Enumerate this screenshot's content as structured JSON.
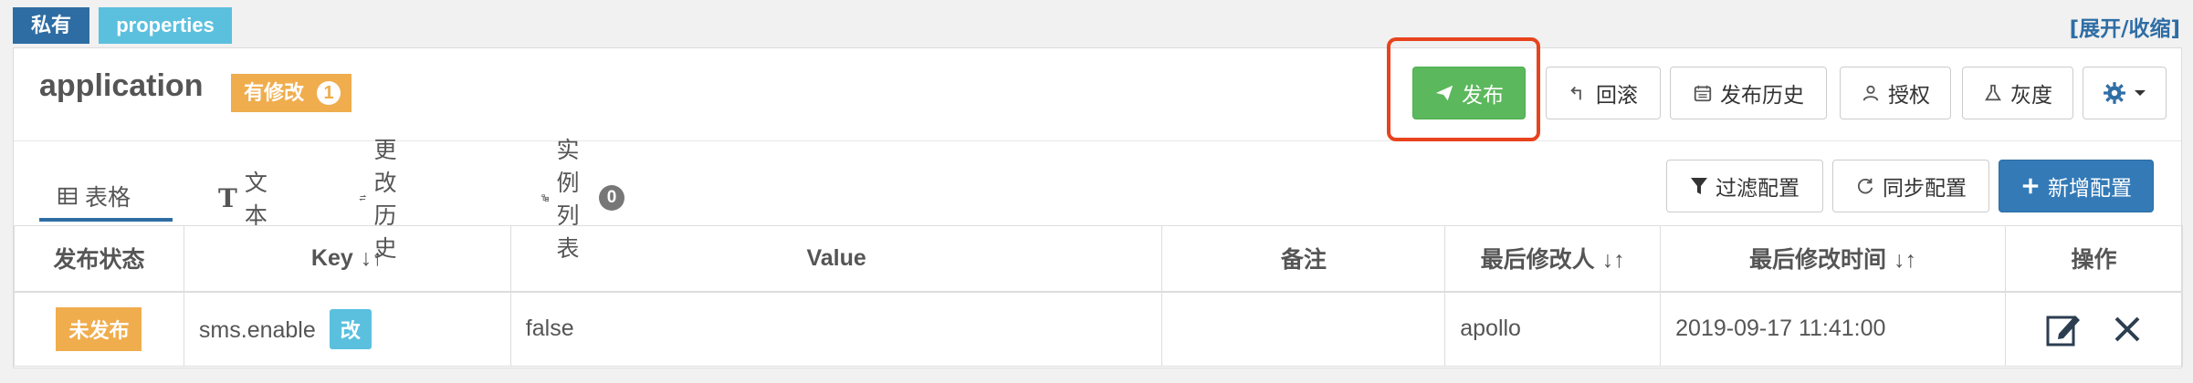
{
  "tags": {
    "private": "私有",
    "properties": "properties"
  },
  "toggle": "[展开/收缩]",
  "namespace": {
    "name": "application",
    "modified_label": "有修改",
    "modified_count": "1"
  },
  "toolbar": {
    "publish": "发布",
    "rollback": "回滚",
    "history": "发布历史",
    "authorize": "授权",
    "gray": "灰度"
  },
  "tabs": {
    "table": "表格",
    "text": "文本",
    "history": "更改历史",
    "instances": "实例列表",
    "instances_count": "0"
  },
  "actions": {
    "filter": "过滤配置",
    "sync": "同步配置",
    "add": "新增配置"
  },
  "table": {
    "headers": {
      "status": "发布状态",
      "key": "Key",
      "value": "Value",
      "comment": "备注",
      "modifier": "最后修改人",
      "time": "最后修改时间",
      "ops": "操作"
    },
    "rows": [
      {
        "status": "未发布",
        "key": "sms.enable",
        "change": "改",
        "value": "false",
        "comment": "",
        "modifier": "apollo",
        "time": "2019-09-17 11:41:00"
      }
    ]
  },
  "colors": {
    "primary": "#337ab7",
    "success": "#5cb85c",
    "warning": "#f0ad4e",
    "info": "#5bc0de",
    "highlight": "#e8431d"
  }
}
